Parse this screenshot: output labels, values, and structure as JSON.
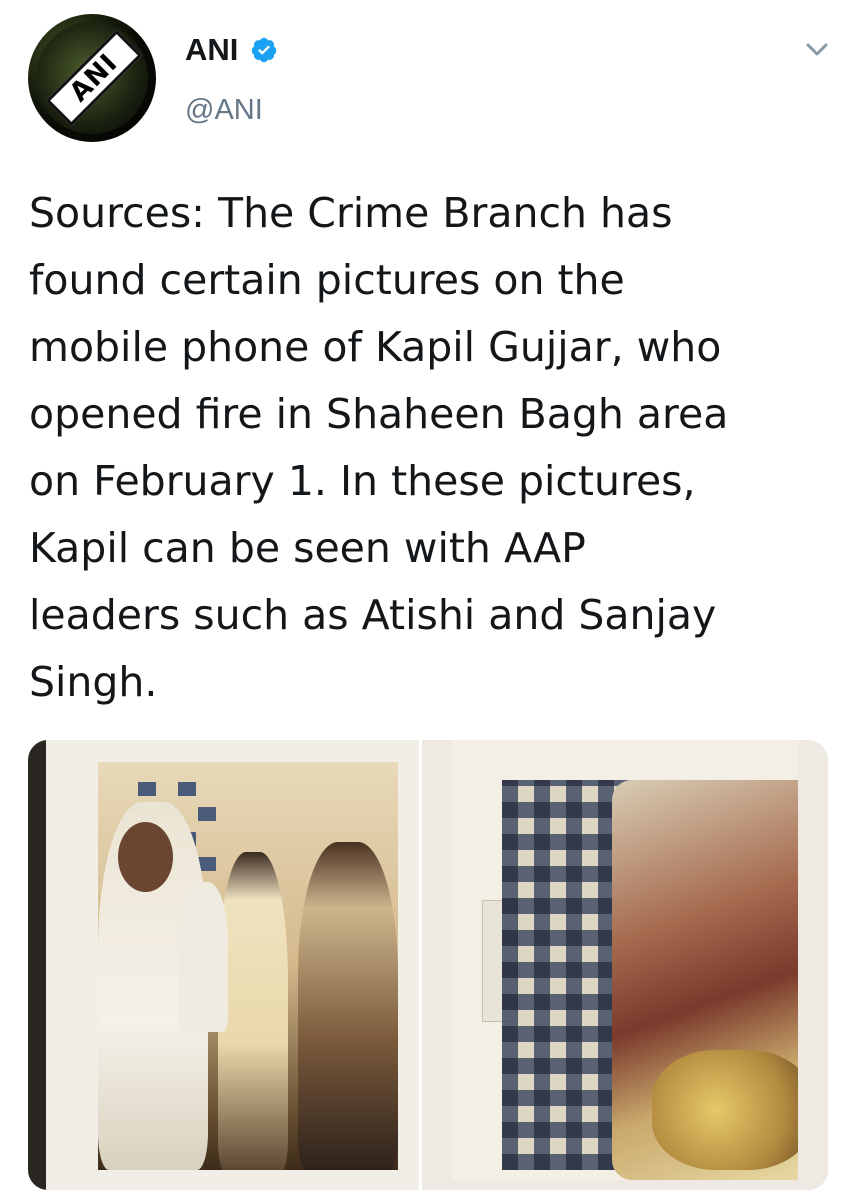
{
  "tweet": {
    "display_name": "ANI",
    "handle": "@ANI",
    "avatar_text": "ANI",
    "verified": true,
    "text": "Sources: The Crime Branch has\nfound certain pictures on the\nmobile phone of Kapil Gujjar, who\nopened fire in Shaheen Bagh area\non February 1. In these pictures,\nKapil can be seen with AAP\nleaders such as Atishi and Sanjay\nSingh.",
    "media_count": 2
  },
  "icons": {
    "verified": "verified-badge-icon",
    "menu": "chevron-down-icon"
  },
  "colors": {
    "verified_blue": "#1da1f2",
    "text_primary": "#14171a",
    "text_secondary": "#657786"
  }
}
